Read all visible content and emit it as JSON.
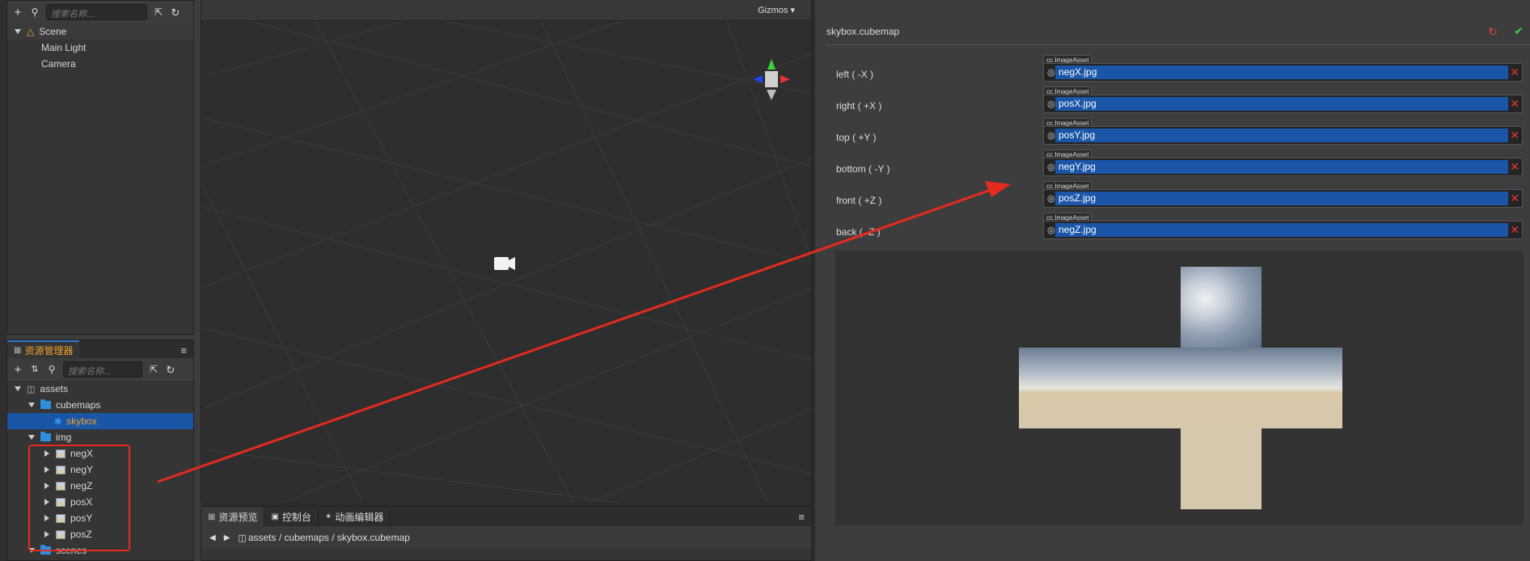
{
  "hierarchy": {
    "search_placeholder": "搜索名称...",
    "items": [
      {
        "label": "Scene"
      },
      {
        "label": "Main Light"
      },
      {
        "label": "Camera"
      }
    ]
  },
  "assets_panel": {
    "tab_label": "资源管理器",
    "search_placeholder": "搜索名称...",
    "root": "assets",
    "folder_cubemaps": "cubemaps",
    "skybox": "skybox",
    "folder_img": "img",
    "images": [
      {
        "label": "negX"
      },
      {
        "label": "negY"
      },
      {
        "label": "negZ"
      },
      {
        "label": "posX"
      },
      {
        "label": "posY"
      },
      {
        "label": "posZ"
      }
    ],
    "folder_scenes": "scenes"
  },
  "scene_view": {
    "gizmos_label": "Gizmos"
  },
  "bottom_dock": {
    "tabs": [
      {
        "label": "资源预览"
      },
      {
        "label": "控制台"
      },
      {
        "label": "动画编辑器"
      }
    ],
    "path": "assets / cubemaps / skybox.cubemap"
  },
  "inspector": {
    "title": "skybox.cubemap",
    "asset_type": "cc.ImageAsset",
    "faces": [
      {
        "label": "left ( -X )",
        "value": "negX.jpg"
      },
      {
        "label": "right ( +X )",
        "value": "posX.jpg"
      },
      {
        "label": "top ( +Y )",
        "value": "posY.jpg"
      },
      {
        "label": "bottom ( -Y )",
        "value": "negY.jpg"
      },
      {
        "label": "front ( +Z )",
        "value": "posZ.jpg"
      },
      {
        "label": "back ( -Z )",
        "value": "negZ.jpg"
      }
    ]
  },
  "colors": {
    "selection": "#1a56a6",
    "annotation": "#e52a20",
    "accent": "#f0a030"
  }
}
